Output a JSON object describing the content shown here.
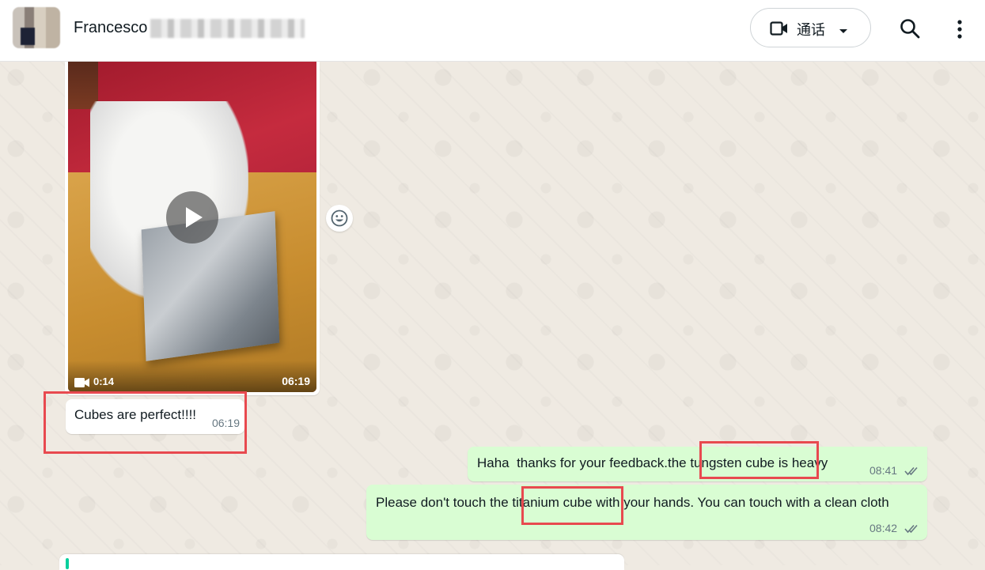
{
  "header": {
    "contact_name": "Francesco",
    "call_button_label": "通话",
    "icons": {
      "video": "video-camera-icon",
      "caret": "caret-down-icon",
      "search": "search-icon",
      "menu": "more-vertical-icon"
    }
  },
  "messages": {
    "video": {
      "duration": "0:14",
      "time": "06:19",
      "play_icon": "play-icon",
      "react_icon": "emoji-icon"
    },
    "incoming_text": {
      "text": "Cubes are perfect!!!!",
      "time": "06:19"
    },
    "outgoing": [
      {
        "text": "Haha  thanks for your feedback.the tungsten cube is heavy",
        "time": "08:41",
        "status_icon": "double-check-icon"
      },
      {
        "text": "Please don't touch the titanium cube with your hands.  You can touch with a clean cloth",
        "time": "08:42",
        "status_icon": "double-check-icon"
      }
    ]
  },
  "colors": {
    "outgoing_bubble": "#d9fdd3",
    "incoming_bubble": "#ffffff",
    "chat_background": "#efeae2",
    "annotation": "#e8494f"
  }
}
